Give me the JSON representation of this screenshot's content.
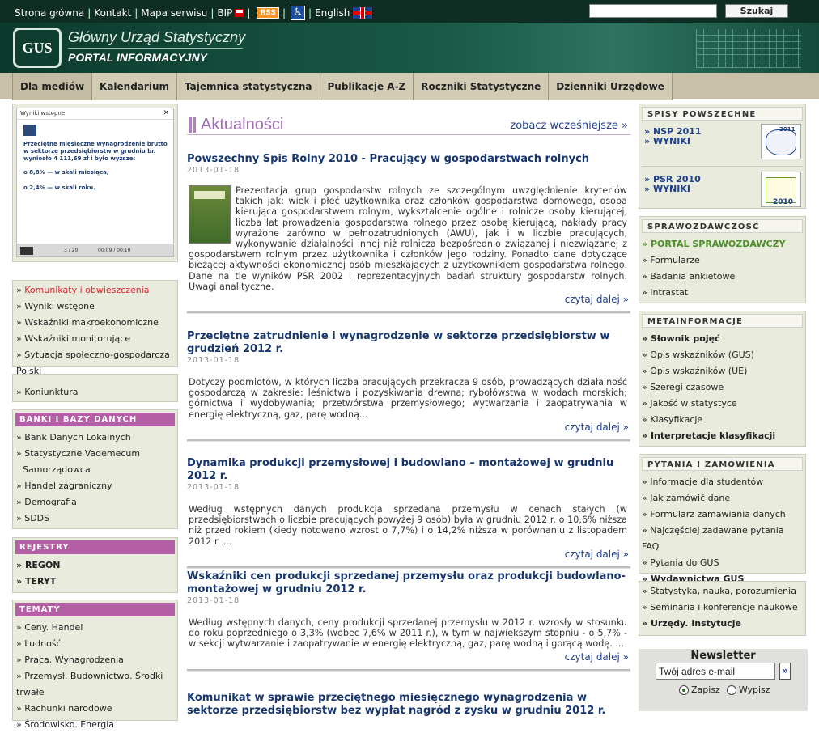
{
  "top": {
    "links": [
      "Strona główna",
      "Kontakt",
      "Mapa serwisu",
      "BIP",
      "English"
    ],
    "rss": "RSS",
    "search_button": "Szukaj",
    "search_value": ""
  },
  "header": {
    "logo": "GUS",
    "title": "Główny Urząd Statystyczny",
    "subtitle": "PORTAL INFORMACYJNY"
  },
  "nav": [
    "Dla mediów",
    "Kalendarium",
    "Tajemnica statystyczna",
    "Publikacje A-Z",
    "Roczniki Statystyczne",
    "Dzienniki Urzędowe"
  ],
  "video": {
    "bar_title": "Wyniki wstępne",
    "text": "Przeciętne miesięczne wynagrodzenie brutto w sektorze przedsiębiorstw w grudniu br. wyniosło 4 111,69 zł i było wyższe:",
    "bullet1": "o 8,8% — w skali miesiąca,",
    "bullet2": "o 2,4% — w skali roku.",
    "slide": "3 / 20",
    "time": "00:09 / 00:10"
  },
  "left": {
    "box1": [
      "Komunikaty i obwieszczenia",
      "Wyniki wstępne",
      "Wskaźniki makroekonomiczne",
      "Wskaźniki monitorujące",
      "Sytuacja społeczno-gospodarcza Polski"
    ],
    "box2": [
      "Koniunktura"
    ],
    "banki_title": "BANKI I BAZY DANYCH",
    "banki": [
      "Bank Danych Lokalnych",
      "Statystyczne Vademecum",
      "Samorządowca",
      "Handel zagraniczny",
      "Demografia",
      "SDDS"
    ],
    "rejestry_title": "REJESTRY",
    "rejestry": [
      "REGON",
      "TERYT"
    ],
    "tematy_title": "TEMATY",
    "tematy": [
      "Ceny. Handel",
      "Ludność",
      "Praca. Wynagrodzenia",
      "Przemysł. Budownictwo. Środki trwałe",
      "Rachunki narodowe",
      "Środowisko. Energia"
    ]
  },
  "main": {
    "heading": "Aktualności",
    "see_earlier": "zobacz wcześniejsze »",
    "read_more": "czytaj dalej »",
    "articles": [
      {
        "title": "Powszechny Spis Rolny 2010 - Pracujący w gospodarstwach rolnych",
        "date": "2013-01-18",
        "body": "Prezentacja grup gospodarstw rolnych ze szczególnym uwzględnienie kryteriów takich jak: wiek i płeć użytkownika oraz członków gospodarstwa domowego, osoba kierująca gospodarstwem rolnym, wykształcenie ogólne i rolnicze osoby kierującej, liczba lat prowadzenia gospodarstwa rolnego przez osobę kierującą, nakłady pracy wyrażone zarówno w pełnozatrudnionych (AWU), jak i w liczbie pracujących, wykonywanie działalności innej niż rolnicza bezpośrednio związanej i niezwiązanej z gospodarstwem rolnym przez użytkownika i członków jego rodziny. Ponadto dane dotyczące bieżącej aktywności ekonomicznej osób mieszkających z użytkownikiem gospodarstwa rolnego. Dane na tle wyników PSR 2002 i reprezentacyjnych badań struktury gospodarstw rolnych. Uwagi analityczne."
      },
      {
        "title": "Przeciętne zatrudnienie i wynagrodzenie w sektorze przedsiębiorstw w grudzień 2012 r.",
        "date": "2013-01-18",
        "body": "Dotyczy podmiotów, w których liczba pracujących przekracza 9 osób, prowadzących działalność gospodarczą w zakresie: leśnictwa i pozyskiwania drewna; rybołówstwa w wodach morskich; górnictwa i wydobywania; przetwórstwa przemysłowego; wytwarzania i zaopatrywania w energię elektryczną, gaz, parę wodną..."
      },
      {
        "title": "Dynamika produkcji przemysłowej i budowlano – montażowej w grudniu 2012 r.",
        "date": "2013-01-18",
        "body": "Według wstępnych danych produkcja sprzedana przemysłu w cenach stałych (w przedsiębiorstwach o liczbie pracujących powyżej 9 osób) była w grudniu 2012 r. o 10,6% niższa niż przed rokiem (kiedy notowano wzrost o 7,7%) i o 14,2% niższa w porównaniu z listopadem 2012 r. ..."
      },
      {
        "title": "Wskaźniki cen produkcji sprzedanej przemysłu oraz produkcji budowlano-montażowej w grudniu 2012 r.",
        "date": "2013-01-18",
        "body": "Według wstępnych danych, ceny produkcji sprzedanej przemysłu w 2012 r. wzrosły w stosunku do roku poprzedniego o 3,3% (wobec 7,6% w 2011 r.), w tym w największym stopniu - o 5,7% - w sekcji wytwarzanie i zaopatrywanie w energię elektryczną, gaz, parę wodną i gorącą wodę. ..."
      },
      {
        "title": "Komunikat w sprawie przeciętnego miesięcznego wynagrodzenia w sektorze przedsiębiorstw bez wypłat nagród z zysku w grudniu 2012 r.",
        "date": "",
        "body": ""
      }
    ]
  },
  "right": {
    "spisy_title": "SPISY POWSZECHNE",
    "nsp": "NSP 2011",
    "nsp_wyniki": "WYNIKI",
    "psr": "PSR 2010",
    "psr_wyniki": "WYNIKI",
    "nsp_badge": "2011",
    "psr_badge": "2010",
    "spraw_title": "SPRAWOZDAWCZOŚĆ",
    "spraw": [
      "PORTAL SPRAWOZDAWCZY",
      "Formularze",
      "Badania ankietowe",
      "Intrastat"
    ],
    "meta_title": "METAINFORMACJE",
    "meta": [
      "Słownik pojęć",
      "Opis wskaźników (GUS)",
      "Opis wskaźników (UE)",
      "Szeregi czasowe",
      "Jakość w statystyce",
      "Klasyfikacje",
      "Interpretacje klasyfikacji"
    ],
    "pyt_title": "PYTANIA I ZAMÓWIENIA",
    "pyt": [
      "Informacje dla studentów",
      "Jak zamówić dane",
      "Formularz zamawiania danych",
      "Najczęściej zadawane pytania FAQ",
      "Pytania do GUS",
      "Wydawnictwa GUS"
    ],
    "misc": [
      "Statystyka, nauka, porozumienia",
      "Seminaria i konferencje naukowe",
      "Urzędy. Instytucje"
    ],
    "newsletter_title": "Newsletter",
    "newsletter_value": "Twój adres e-mail",
    "go": "»",
    "zapisz": "Zapisz",
    "wypisz": "Wypisz"
  }
}
